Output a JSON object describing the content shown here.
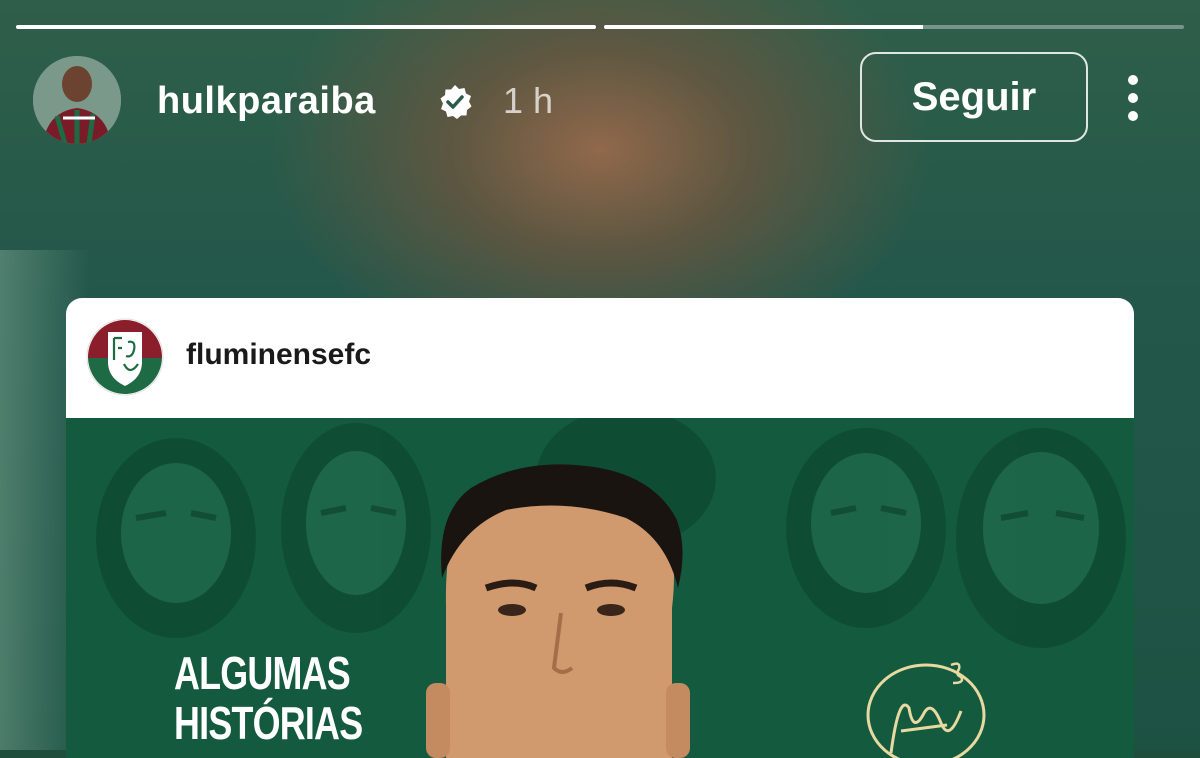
{
  "story": {
    "progress": [
      1.0,
      0.55
    ],
    "username": "hulkparaiba",
    "time": "1 h",
    "follow_label": "Seguir"
  },
  "post": {
    "account": "fluminensefc",
    "headline_line1": "ALGUMAS",
    "headline_line2": "HISTÓRIAS"
  },
  "colors": {
    "story_bg": "#23574a",
    "post_bg": "#125237",
    "club_red": "#8a1f2b",
    "club_green": "#1e6a44"
  },
  "icons": [
    "verified-badge-icon",
    "more-options-icon",
    "fluminense-crest-icon",
    "signature-logo-icon"
  ]
}
